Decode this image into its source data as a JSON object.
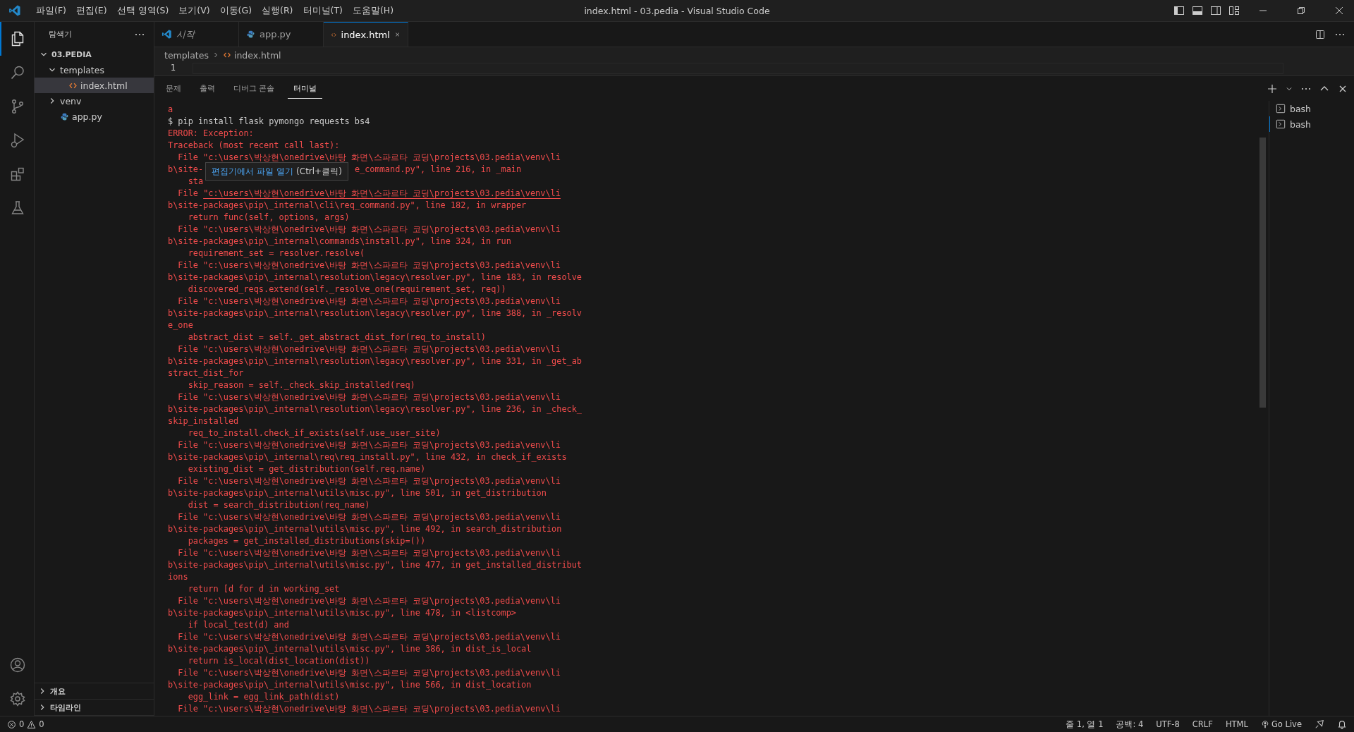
{
  "window": {
    "title": "index.html - 03.pedia - Visual Studio Code",
    "menu": [
      "파일(F)",
      "편집(E)",
      "선택 영역(S)",
      "보기(V)",
      "이동(G)",
      "실행(R)",
      "터미널(T)",
      "도움말(H)"
    ]
  },
  "activity_bar": {
    "top": [
      {
        "kind": "files",
        "selected": true
      },
      {
        "kind": "search",
        "selected": false
      },
      {
        "kind": "source-control",
        "selected": false
      },
      {
        "kind": "run-debug",
        "selected": false
      },
      {
        "kind": "extensions",
        "selected": false
      },
      {
        "kind": "testing",
        "selected": false
      }
    ],
    "bottom": [
      {
        "kind": "account"
      },
      {
        "kind": "manage"
      }
    ]
  },
  "sidebar": {
    "title": "탐색기",
    "tree": [
      {
        "label": "03.PEDIA",
        "kind": "root",
        "expanded": true,
        "selected": false,
        "children": [
          {
            "label": "templates",
            "kind": "folder",
            "expanded": true,
            "selected": false,
            "children": [
              {
                "label": "index.html",
                "kind": "html",
                "selected": true
              }
            ]
          },
          {
            "label": "venv",
            "kind": "folder",
            "expanded": false,
            "selected": false
          },
          {
            "label": "app.py",
            "kind": "python",
            "selected": false
          }
        ]
      }
    ],
    "sections": [
      {
        "label": "개요",
        "expanded": false
      },
      {
        "label": "타임라인",
        "expanded": false
      }
    ]
  },
  "tabs": [
    {
      "label": "시작",
      "kind": "welcome",
      "selected": false,
      "preview": true
    },
    {
      "label": "app.py",
      "kind": "python",
      "selected": false,
      "preview": false
    },
    {
      "label": "index.html",
      "kind": "html",
      "selected": true,
      "preview": false
    }
  ],
  "breadcrumb": [
    "templates",
    "index.html"
  ],
  "editor": {
    "line_numbers": [
      "1"
    ]
  },
  "panel": {
    "tabs": [
      {
        "label": "문제",
        "selected": false
      },
      {
        "label": "출력",
        "selected": false
      },
      {
        "label": "디버그 콘솔",
        "selected": false
      },
      {
        "label": "터미널",
        "selected": true
      }
    ],
    "terminal": {
      "lines": [
        {
          "kind": "error",
          "text": "a"
        },
        {
          "kind": "command",
          "text": "$ pip install flask pymongo requests bs4"
        },
        {
          "kind": "error",
          "text": "ERROR: Exception:"
        },
        {
          "kind": "error",
          "text": "Traceback (most recent call last):"
        },
        {
          "kind": "error",
          "text": "  File \"c:\\users\\박상현\\onedrive\\바탕 화면\\스파르타 코딩\\projects\\03.pedia\\venv\\li"
        },
        {
          "kind": "covered",
          "parts": [
            "b\\site-",
            "e_command.py\", line 216, in _main"
          ]
        },
        {
          "kind": "error",
          "text": "    sta"
        },
        {
          "kind": "hovered",
          "parts": [
            "  File ",
            "\"c:\\users\\박상현\\onedrive\\바탕 화면\\스파르타 코딩\\projects\\03.pedia\\venv\\li"
          ]
        },
        {
          "kind": "error",
          "text": "b\\site-packages\\pip\\_internal\\cli\\req_command.py\", line 182, in wrapper"
        },
        {
          "kind": "error",
          "text": "    return func(self, options, args)"
        },
        {
          "kind": "error",
          "text": "  File \"c:\\users\\박상현\\onedrive\\바탕 화면\\스파르타 코딩\\projects\\03.pedia\\venv\\li"
        },
        {
          "kind": "error",
          "text": "b\\site-packages\\pip\\_internal\\commands\\install.py\", line 324, in run"
        },
        {
          "kind": "error",
          "text": "    requirement_set = resolver.resolve("
        },
        {
          "kind": "error",
          "text": "  File \"c:\\users\\박상현\\onedrive\\바탕 화면\\스파르타 코딩\\projects\\03.pedia\\venv\\li"
        },
        {
          "kind": "error",
          "text": "b\\site-packages\\pip\\_internal\\resolution\\legacy\\resolver.py\", line 183, in resolve"
        },
        {
          "kind": "error",
          "text": "    discovered_reqs.extend(self._resolve_one(requirement_set, req))"
        },
        {
          "kind": "error",
          "text": "  File \"c:\\users\\박상현\\onedrive\\바탕 화면\\스파르타 코딩\\projects\\03.pedia\\venv\\li"
        },
        {
          "kind": "error",
          "text": "b\\site-packages\\pip\\_internal\\resolution\\legacy\\resolver.py\", line 388, in _resolv"
        },
        {
          "kind": "error",
          "text": "e_one"
        },
        {
          "kind": "error",
          "text": "    abstract_dist = self._get_abstract_dist_for(req_to_install)"
        },
        {
          "kind": "error",
          "text": "  File \"c:\\users\\박상현\\onedrive\\바탕 화면\\스파르타 코딩\\projects\\03.pedia\\venv\\li"
        },
        {
          "kind": "error",
          "text": "b\\site-packages\\pip\\_internal\\resolution\\legacy\\resolver.py\", line 331, in _get_ab"
        },
        {
          "kind": "error",
          "text": "stract_dist_for"
        },
        {
          "kind": "error",
          "text": "    skip_reason = self._check_skip_installed(req)"
        },
        {
          "kind": "error",
          "text": "  File \"c:\\users\\박상현\\onedrive\\바탕 화면\\스파르타 코딩\\projects\\03.pedia\\venv\\li"
        },
        {
          "kind": "error",
          "text": "b\\site-packages\\pip\\_internal\\resolution\\legacy\\resolver.py\", line 236, in _check_"
        },
        {
          "kind": "error",
          "text": "skip_installed"
        },
        {
          "kind": "error",
          "text": "    req_to_install.check_if_exists(self.use_user_site)"
        },
        {
          "kind": "error",
          "text": "  File \"c:\\users\\박상현\\onedrive\\바탕 화면\\스파르타 코딩\\projects\\03.pedia\\venv\\li"
        },
        {
          "kind": "error",
          "text": "b\\site-packages\\pip\\_internal\\req\\req_install.py\", line 432, in check_if_exists"
        },
        {
          "kind": "error",
          "text": "    existing_dist = get_distribution(self.req.name)"
        },
        {
          "kind": "error",
          "text": "  File \"c:\\users\\박상현\\onedrive\\바탕 화면\\스파르타 코딩\\projects\\03.pedia\\venv\\li"
        },
        {
          "kind": "error",
          "text": "b\\site-packages\\pip\\_internal\\utils\\misc.py\", line 501, in get_distribution"
        },
        {
          "kind": "error",
          "text": "    dist = search_distribution(req_name)"
        },
        {
          "kind": "error",
          "text": "  File \"c:\\users\\박상현\\onedrive\\바탕 화면\\스파르타 코딩\\projects\\03.pedia\\venv\\li"
        },
        {
          "kind": "error",
          "text": "b\\site-packages\\pip\\_internal\\utils\\misc.py\", line 492, in search_distribution"
        },
        {
          "kind": "error",
          "text": "    packages = get_installed_distributions(skip=())"
        },
        {
          "kind": "error",
          "text": "  File \"c:\\users\\박상현\\onedrive\\바탕 화면\\스파르타 코딩\\projects\\03.pedia\\venv\\li"
        },
        {
          "kind": "error",
          "text": "b\\site-packages\\pip\\_internal\\utils\\misc.py\", line 477, in get_installed_distribut"
        },
        {
          "kind": "error",
          "text": "ions"
        },
        {
          "kind": "error",
          "text": "    return [d for d in working_set"
        },
        {
          "kind": "error",
          "text": "  File \"c:\\users\\박상현\\onedrive\\바탕 화면\\스파르타 코딩\\projects\\03.pedia\\venv\\li"
        },
        {
          "kind": "error",
          "text": "b\\site-packages\\pip\\_internal\\utils\\misc.py\", line 478, in <listcomp>"
        },
        {
          "kind": "error",
          "text": "    if local_test(d) and"
        },
        {
          "kind": "error",
          "text": "  File \"c:\\users\\박상현\\onedrive\\바탕 화면\\스파르타 코딩\\projects\\03.pedia\\venv\\li"
        },
        {
          "kind": "error",
          "text": "b\\site-packages\\pip\\_internal\\utils\\misc.py\", line 386, in dist_is_local"
        },
        {
          "kind": "error",
          "text": "    return is_local(dist_location(dist))"
        },
        {
          "kind": "error",
          "text": "  File \"c:\\users\\박상현\\onedrive\\바탕 화면\\스파르타 코딩\\projects\\03.pedia\\venv\\li"
        },
        {
          "kind": "error",
          "text": "b\\site-packages\\pip\\_internal\\utils\\misc.py\", line 566, in dist_location"
        },
        {
          "kind": "error",
          "text": "    egg_link = egg_link_path(dist)"
        },
        {
          "kind": "error",
          "text": "  File \"c:\\users\\박상현\\onedrive\\바탕 화면\\스파르타 코딩\\projects\\03.pedia\\venv\\li"
        }
      ]
    },
    "tooltip": {
      "link": "편집기에서 파일 열기",
      "hint": "(Ctrl+클릭)"
    },
    "terminals": [
      {
        "label": "bash",
        "selected": false
      },
      {
        "label": "bash",
        "selected": true
      }
    ]
  },
  "status_bar": {
    "errors": "0",
    "warnings": "0",
    "items": [
      "줄 1, 열 1",
      "공백: 4",
      "UTF-8",
      "CRLF",
      "HTML"
    ],
    "go_live": "Go Live"
  }
}
